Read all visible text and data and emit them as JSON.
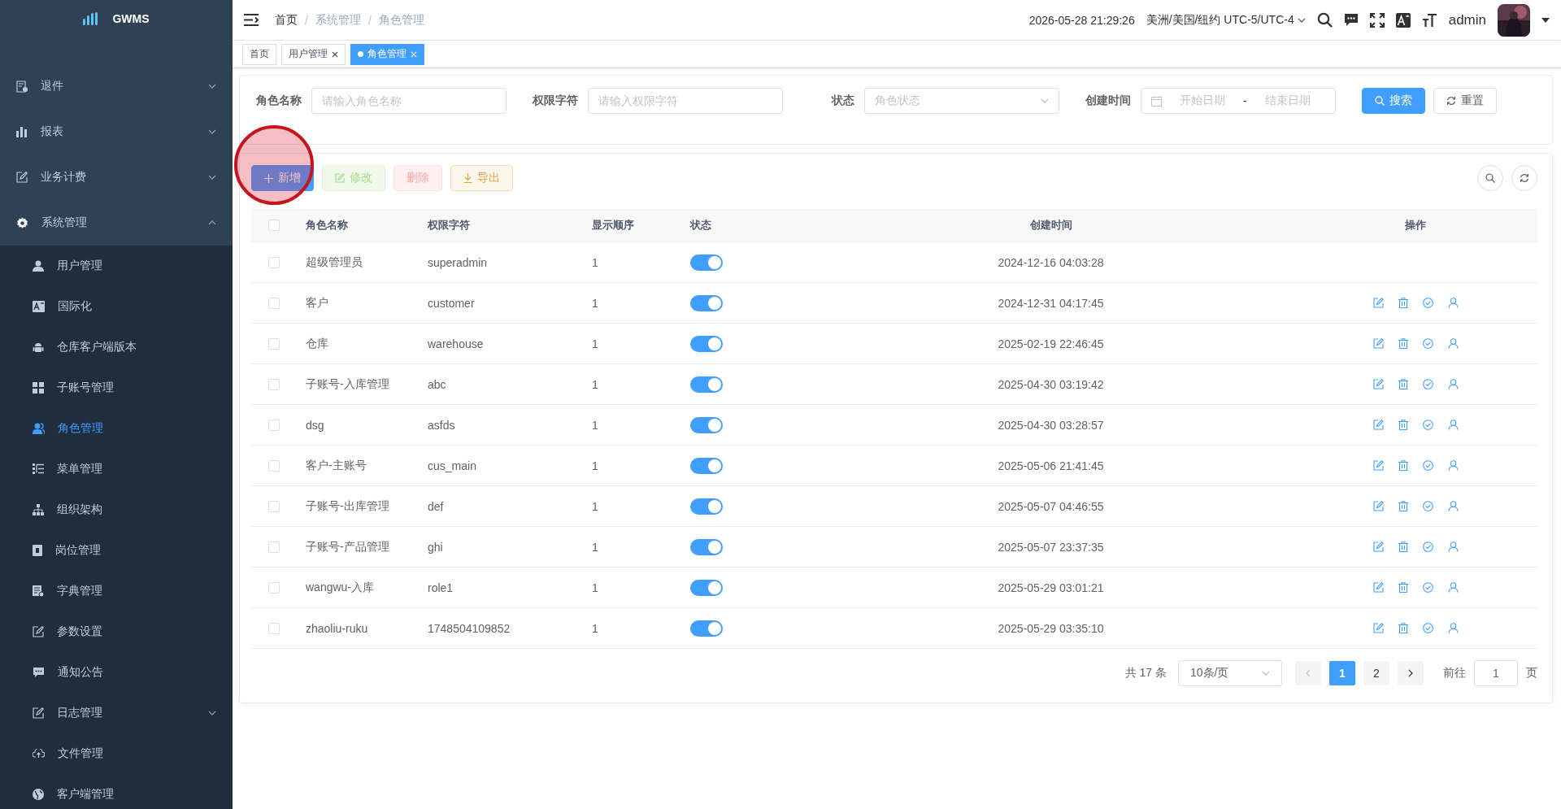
{
  "sidebar": {
    "logo": "GWMS",
    "items": [
      {
        "label": "退件",
        "expanded": false
      },
      {
        "label": "报表",
        "expanded": false
      },
      {
        "label": "业务计费",
        "expanded": false
      },
      {
        "label": "系统管理",
        "expanded": true,
        "children": [
          {
            "label": "用户管理",
            "kind": "item",
            "selected": false
          },
          {
            "label": "国际化",
            "kind": "item",
            "selected": false
          },
          {
            "label": "仓库客户端版本",
            "kind": "item",
            "selected": false
          },
          {
            "label": "子账号管理",
            "kind": "item",
            "selected": false
          },
          {
            "label": "角色管理",
            "kind": "item",
            "selected": true
          },
          {
            "label": "菜单管理",
            "kind": "item",
            "selected": false
          },
          {
            "label": "组织架构",
            "kind": "item",
            "selected": false
          },
          {
            "label": "岗位管理",
            "kind": "item",
            "selected": false
          },
          {
            "label": "字典管理",
            "kind": "item",
            "selected": false
          },
          {
            "label": "参数设置",
            "kind": "item",
            "selected": false
          },
          {
            "label": "通知公告",
            "kind": "item",
            "selected": false
          },
          {
            "label": "日志管理",
            "kind": "group",
            "selected": false,
            "expanded": false
          },
          {
            "label": "文件管理",
            "kind": "item",
            "selected": false
          },
          {
            "label": "客户端管理",
            "kind": "item",
            "selected": false
          }
        ]
      }
    ]
  },
  "header": {
    "breadcrumb": {
      "separator": "/",
      "items": [
        "首页",
        "系统管理",
        "角色管理"
      ]
    },
    "datetime": "2026-05-28 21:29:26",
    "timezone": "美洲/美国/纽约 UTC-5/UTC-4",
    "user": "admin"
  },
  "tags": [
    {
      "label": "首页",
      "closable": false,
      "selected": false
    },
    {
      "label": "用户管理",
      "closable": true,
      "selected": false
    },
    {
      "label": "角色管理",
      "closable": true,
      "selected": true
    }
  ],
  "search": {
    "fields": [
      {
        "label": "角色名称",
        "kind": "input",
        "placeholder": "请输入角色名称"
      },
      {
        "label": "权限字符",
        "kind": "input",
        "placeholder": "请输入权限字符"
      },
      {
        "label": "状态",
        "kind": "select",
        "placeholder": "角色状态"
      },
      {
        "label": "创建时间",
        "kind": "daterange",
        "placeholder": "开始日期",
        "separator": "-",
        "placeholder_end": "结束日期"
      }
    ],
    "buttons": [
      {
        "label": "搜索",
        "kind": "primary"
      },
      {
        "label": "重置",
        "kind": "default"
      }
    ]
  },
  "toolbar": {
    "buttons": [
      {
        "label": "新增",
        "kind": "primary",
        "disabled": false,
        "highlighted": true
      },
      {
        "label": "修改",
        "kind": "success",
        "disabled": true,
        "highlighted": false
      },
      {
        "label": "删除",
        "kind": "danger",
        "disabled": true,
        "highlighted": false
      },
      {
        "label": "导出",
        "kind": "warning",
        "disabled": false,
        "highlighted": false
      }
    ]
  },
  "table": {
    "all_checked": false,
    "columns": [
      "角色名称",
      "权限字符",
      "显示顺序",
      "状态",
      "创建时间",
      "操作"
    ],
    "rows": [
      {
        "checked": false,
        "name": "超级管理员",
        "key": "superadmin",
        "sort": "1",
        "enabled": true,
        "created": "2024-12-16 04:03:28",
        "show_actions": false
      },
      {
        "checked": false,
        "name": "客户",
        "key": "customer",
        "sort": "1",
        "enabled": true,
        "created": "2024-12-31 04:17:45",
        "show_actions": true
      },
      {
        "checked": false,
        "name": "仓库",
        "key": "warehouse",
        "sort": "1",
        "enabled": true,
        "created": "2025-02-19 22:46:45",
        "show_actions": true
      },
      {
        "checked": false,
        "name": "子账号-入库管理",
        "key": "abc",
        "sort": "1",
        "enabled": true,
        "created": "2025-04-30 03:19:42",
        "show_actions": true
      },
      {
        "checked": false,
        "name": "dsg",
        "key": "asfds",
        "sort": "1",
        "enabled": true,
        "created": "2025-04-30 03:28:57",
        "show_actions": true
      },
      {
        "checked": false,
        "name": "客户-主账号",
        "key": "cus_main",
        "sort": "1",
        "enabled": true,
        "created": "2025-05-06 21:41:45",
        "show_actions": true
      },
      {
        "checked": false,
        "name": "子账号-出库管理",
        "key": "def",
        "sort": "1",
        "enabled": true,
        "created": "2025-05-07 04:46:55",
        "show_actions": true
      },
      {
        "checked": false,
        "name": "子账号-产品管理",
        "key": "ghi",
        "sort": "1",
        "enabled": true,
        "created": "2025-05-07 23:37:35",
        "show_actions": true
      },
      {
        "checked": false,
        "name": "wangwu-入库",
        "key": "role1",
        "sort": "1",
        "enabled": true,
        "created": "2025-05-29 03:01:21",
        "show_actions": true
      },
      {
        "checked": false,
        "name": "zhaoliu-ruku",
        "key": "1748504109852",
        "sort": "1",
        "enabled": true,
        "created": "2025-05-29 03:35:10",
        "show_actions": true
      }
    ]
  },
  "pagination": {
    "total": "共 17 条",
    "page_size": "10条/页",
    "prev_disabled": true,
    "pages": [
      {
        "label": "1",
        "selected": true
      },
      {
        "label": "2",
        "selected": false
      }
    ],
    "goto_label": "前往",
    "goto_value": "1",
    "page_suffix": "页"
  }
}
